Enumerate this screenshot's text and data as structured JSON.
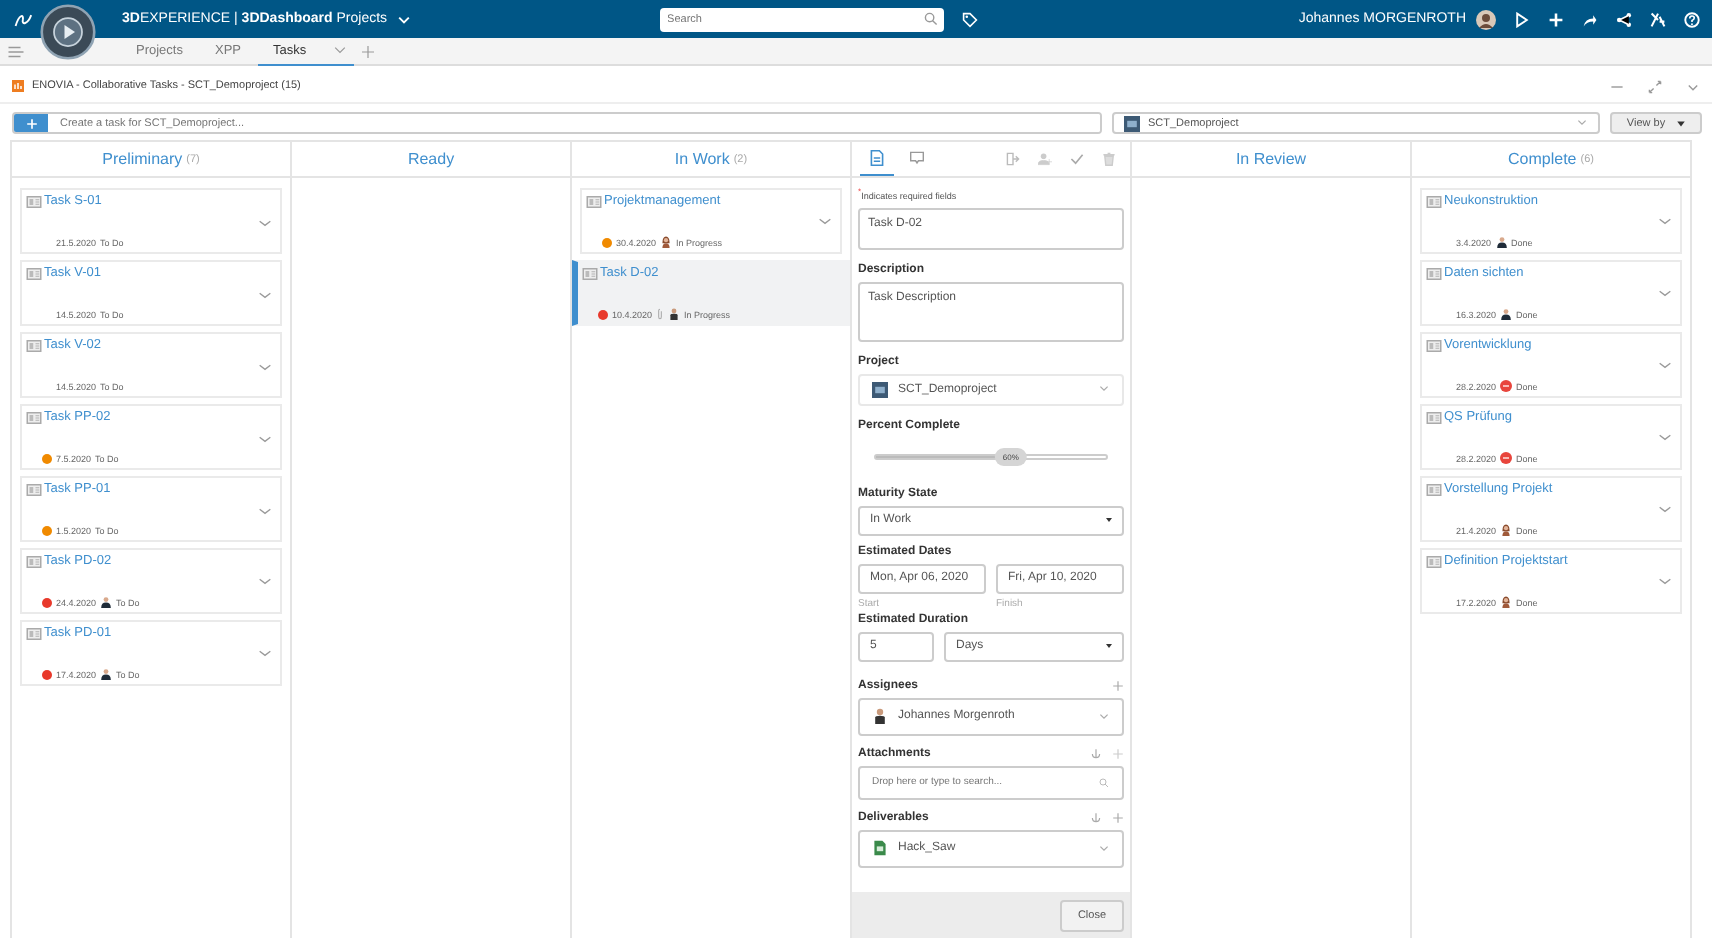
{
  "topbar": {
    "brand": "**3D**EXPERIENCE | **3DDashboard** Projects",
    "search": {
      "placeholder": "Search"
    },
    "user": "Johannes MORGENROTH"
  },
  "tabs": [
    {
      "label": "Projects",
      "selected": false
    },
    {
      "label": "XPP",
      "selected": false
    },
    {
      "label": "Tasks",
      "selected": true
    }
  ],
  "widget": {
    "title": "ENOVIA - Collaborative Tasks - SCT_Demoproject (15)"
  },
  "toolbar": {
    "create": {
      "placeholder": "Create a task for SCT_Demoproject..."
    },
    "project": "SCT_Demoproject",
    "view_by": "View by"
  },
  "columns": [
    {
      "title": "Preliminary",
      "count": "(7)",
      "cards": [
        {
          "title": "Task S-01",
          "date": "21.5.2020",
          "status": "To Do",
          "selected": false
        },
        {
          "title": "Task V-01",
          "date": "14.5.2020",
          "status": "To Do",
          "selected": false
        },
        {
          "title": "Task V-02",
          "date": "14.5.2020",
          "status": "To Do",
          "selected": false
        },
        {
          "title": "Task PP-02",
          "date": "7.5.2020",
          "status": "To Do",
          "color": "#f08a00",
          "selected": false
        },
        {
          "title": "Task PP-01",
          "date": "1.5.2020",
          "status": "To Do",
          "color": "#f08a00",
          "selected": false
        },
        {
          "title": "Task PD-02",
          "date": "24.4.2020",
          "status": "To Do",
          "color": "#e8392b",
          "avatar": {
            "kind": "man"
          },
          "selected": false
        },
        {
          "title": "Task PD-01",
          "date": "17.4.2020",
          "status": "To Do",
          "color": "#e8392b",
          "avatar": {
            "kind": "man"
          },
          "selected": false
        }
      ]
    },
    {
      "title": "Ready"
    },
    {
      "title": "In Work",
      "count": "(2)",
      "cards": [
        {
          "title": "Projektmanagement",
          "date": "30.4.2020",
          "status": "In Progress",
          "color": "#f08a00",
          "avatar": {
            "kind": "woman"
          },
          "selected": false
        },
        {
          "title": "Task D-02",
          "date": "10.4.2020",
          "status": "In Progress",
          "color": "#e8392b",
          "avatar": {
            "kind": "suit"
          },
          "attachment": true,
          "selected": true
        }
      ]
    },
    {
      "title": "In Review"
    },
    {
      "title": "Complete",
      "count": "(6)",
      "cards": [
        {
          "title": "Neukonstruktion",
          "date": "3.4.2020",
          "status": "Done",
          "avatar": {
            "kind": "man"
          },
          "selected": false
        },
        {
          "title": "Daten sichten",
          "date": "16.3.2020",
          "status": "Done",
          "avatar": {
            "kind": "man"
          },
          "selected": false
        },
        {
          "title": "Vorentwicklung",
          "date": "28.2.2020",
          "status": "Done",
          "avatar": {
            "kind": "initials"
          },
          "selected": false
        },
        {
          "title": "QS Prüfung",
          "date": "28.2.2020",
          "status": "Done",
          "avatar": {
            "kind": "initials"
          },
          "selected": false
        },
        {
          "title": "Vorstellung Projekt",
          "date": "21.4.2020",
          "status": "Done",
          "avatar": {
            "kind": "woman"
          },
          "selected": false
        },
        {
          "title": "Definition Projektstart",
          "date": "17.2.2020",
          "status": "Done",
          "avatar": {
            "kind": "woman"
          },
          "selected": false
        }
      ]
    }
  ],
  "details": {
    "tabs": [
      {
        "kind": "properties",
        "selected": true
      },
      {
        "kind": "comments",
        "selected": false
      }
    ],
    "required_note": "$^{*}$Indicates required fields",
    "name": "Task D-02",
    "description_label": "Description",
    "description": "Task Description",
    "project_label": "Project",
    "project": "SCT_Demoproject",
    "percent_label": "Percent Complete",
    "percent": {
      "level": 0.6,
      "reading": "60%"
    },
    "maturity_label": "Maturity State",
    "maturity": "In Work",
    "dates_label": "Estimated Dates",
    "start": "Mon, Apr 06, 2020",
    "finish": "Fri, Apr 10, 2020",
    "start_caption": "Start",
    "finish_caption": "Finish",
    "duration_label": "Estimated Duration",
    "duration": "5",
    "duration_unit": "Days",
    "assignees_label": "Assignees",
    "assignee": "Johannes Morgenroth",
    "attachments_label": "Attachments",
    "attachments": {
      "placeholder": "Drop here or type to search..."
    },
    "deliverables_label": "Deliverables",
    "deliverable": "Hack_Saw",
    "close": "Close"
  }
}
